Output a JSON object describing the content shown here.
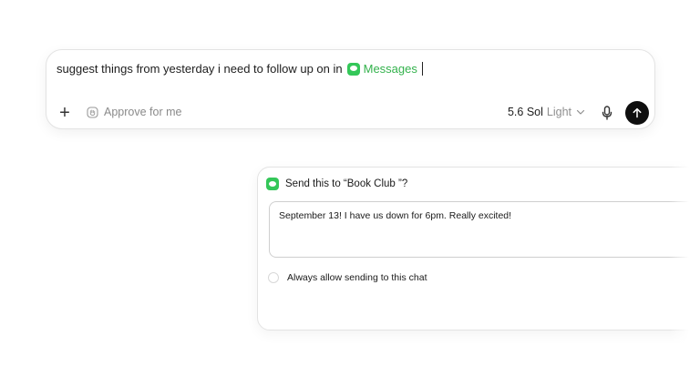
{
  "composer": {
    "prompt_text": "suggest things from yesterday i need to follow up on in",
    "app_chip_label": "Messages",
    "approve_label": "Approve for me",
    "model_name": "5.6 Sol",
    "model_variant": "Light",
    "icons": {
      "add": "plus-icon",
      "approve": "hand-icon",
      "dropdown": "chevron-down-icon",
      "mic": "microphone-icon",
      "send": "arrow-up-icon",
      "app": "messages-icon"
    },
    "colors": {
      "app_accent": "#34c759",
      "send_bg": "#0f0f0f"
    }
  },
  "dialog": {
    "title": "Send this to “Book Club ”?",
    "message": "September 13! I have us down for 6pm. Really excited!",
    "always_allow_label": "Always allow sending to this chat",
    "always_allow_checked": false
  }
}
